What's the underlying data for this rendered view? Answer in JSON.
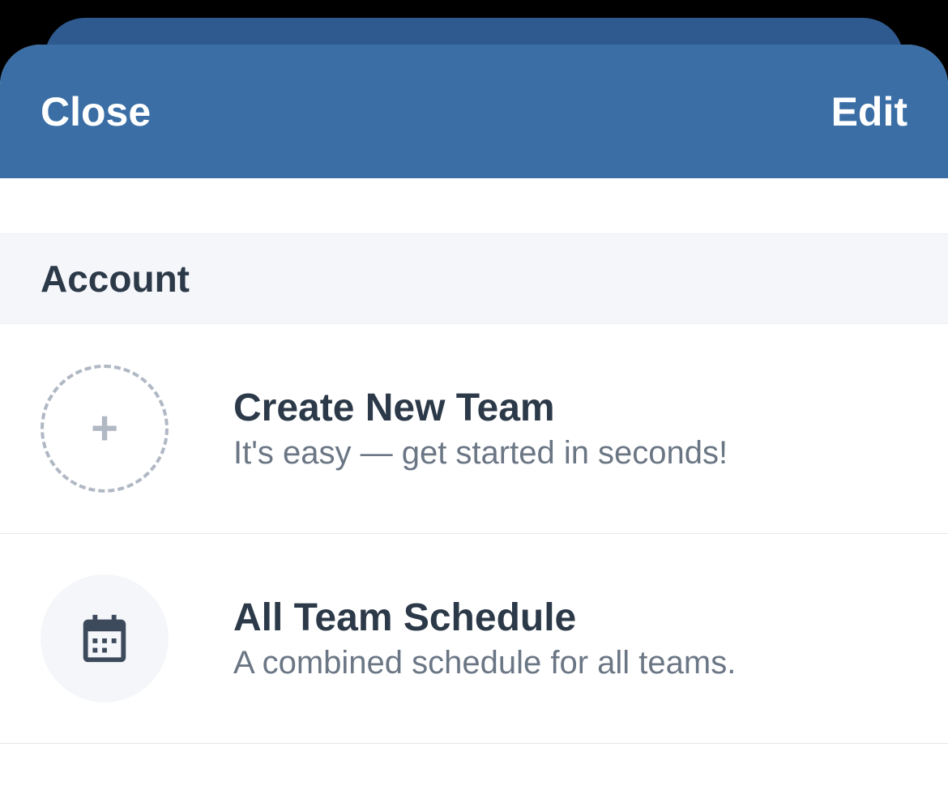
{
  "header": {
    "close_label": "Close",
    "edit_label": "Edit"
  },
  "section": {
    "title": "Account"
  },
  "items": [
    {
      "title": "Create New Team",
      "subtitle": "It's easy — get started in seconds!"
    },
    {
      "title": "All Team Schedule",
      "subtitle": "A combined schedule for all teams."
    }
  ]
}
